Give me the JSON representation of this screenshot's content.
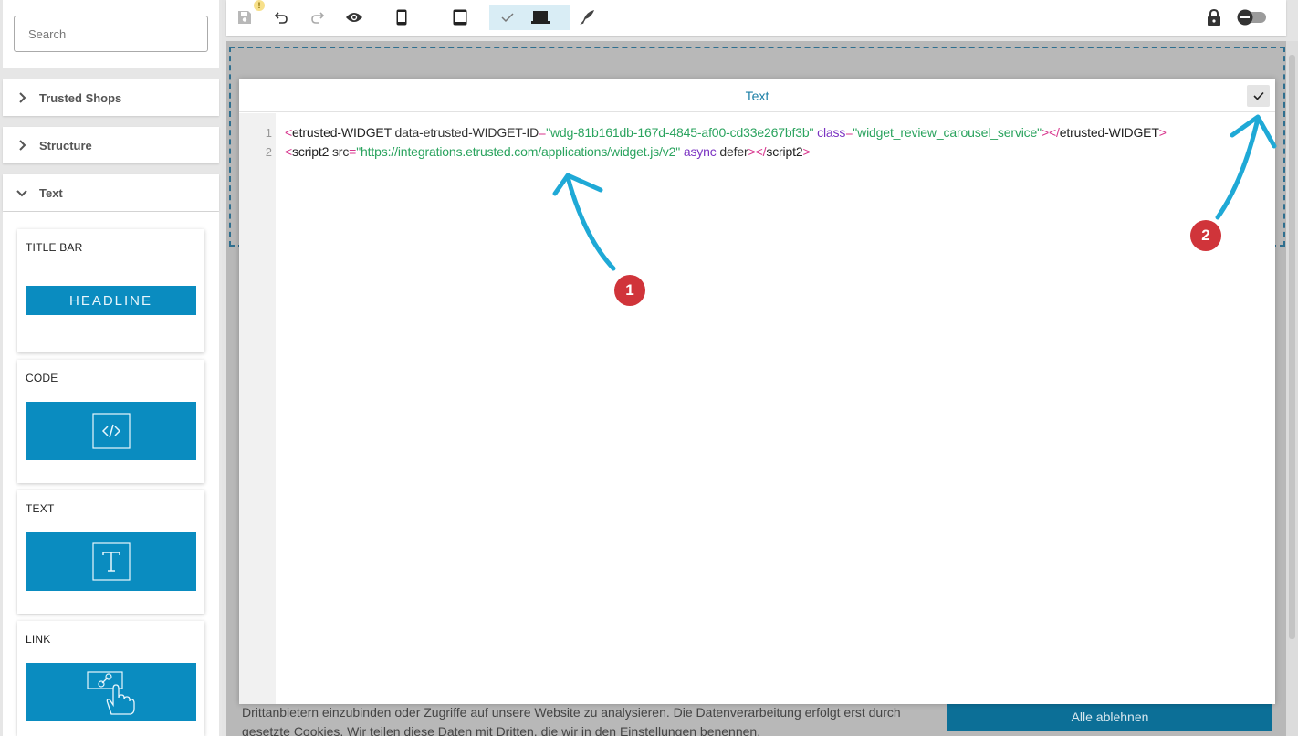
{
  "search": {
    "placeholder": "Search"
  },
  "sidebar": {
    "sections": [
      {
        "label": "Trusted Shops",
        "expanded": false
      },
      {
        "label": "Structure",
        "expanded": false
      },
      {
        "label": "Text",
        "expanded": true
      }
    ],
    "cards": [
      {
        "label": "TITLE BAR",
        "preview_text": "HEADLINE"
      },
      {
        "label": "CODE"
      },
      {
        "label": "TEXT"
      },
      {
        "label": "LINK"
      }
    ]
  },
  "toolbar": {
    "icons": [
      "save-icon",
      "undo-icon",
      "redo-icon",
      "preview-eye-icon",
      "phone-icon",
      "tablet-icon",
      "check-icon",
      "laptop-icon",
      "feather-icon",
      "lock-icon",
      "toggle-switch"
    ],
    "warning_badge": "!"
  },
  "editor": {
    "title": "Text",
    "line_numbers": [
      "1",
      "2"
    ],
    "line1": {
      "p1": "<",
      "tag": "etrusted-WIDGET",
      "attr1": " data-etrusted-WIDGET-ID",
      "eq1": "=",
      "val1": "\"wdg-81b161db-167d-4845-af00-cd33e267bf3b\"",
      "attr2": " class",
      "eq2": "=",
      "val2": "\"widget_review_carousel_service\"",
      "p2": "></",
      "tag_close": "etrusted-WIDGET",
      "p3": ">"
    },
    "line2": {
      "p1": "<",
      "tag": "script2",
      "attr1": " src",
      "eq1": "=",
      "val1": "\"https://integrations.etrusted.com/applications/widget.js/v2\"",
      "kw1": " async",
      "attr2": " defer",
      "p2": "></",
      "tag_close": "script2",
      "p3": ">"
    }
  },
  "cookie": {
    "line1": "Drittanbietern einzubinden oder Zugriffe auf unsere Website zu analysieren. Die Datenverarbeitung erfolgt erst durch",
    "line2": "gesetzte Cookies. Wir teilen diese Daten mit Dritten, die wir in den Einstellungen benennen.",
    "reject_button": "Alle ablehnen"
  },
  "annotations": {
    "badge1": "1",
    "badge2": "2"
  },
  "colors": {
    "accent": "#0a8cc0",
    "title": "#1b7fa6",
    "badge": "#d0343a",
    "arrow": "#1fa9d6"
  }
}
